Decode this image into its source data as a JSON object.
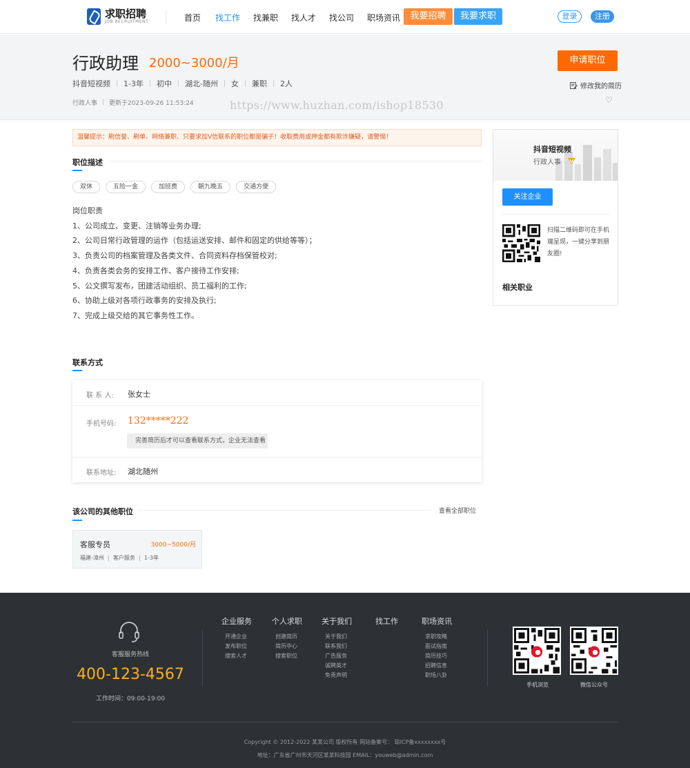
{
  "header": {
    "logo_title": "求职招聘",
    "logo_subtitle": "JOB RECRUITMENT",
    "nav": [
      "首页",
      "找工作",
      "找兼职",
      "找人才",
      "找公司",
      "职场资讯"
    ],
    "active_nav": "找工作",
    "recruit_btn": "我要招聘",
    "seek_btn": "我要求职",
    "login": "登录",
    "register": "注册"
  },
  "job": {
    "title": "行政助理",
    "salary": "2000~3000/月",
    "tags": [
      "抖音短视频",
      "1-3年",
      "初中",
      "湖北-随州",
      "女",
      "兼职",
      "2人"
    ],
    "category": "行政人事",
    "updated": "更新于2023-09-26 11:53:24",
    "apply_btn": "申请职位",
    "edit_resume": "修改我的简历",
    "watermark": "https://www.huzhan.com/ishop18530"
  },
  "warning": "温馨提示：刷信誉、刷单、网络兼职、只要求加V信联系的职位都是骗子！收取费用或押金都有欺诈嫌疑，请警惕！",
  "description": {
    "heading": "职位描述",
    "welfare": [
      "双休",
      "五险一金",
      "加班费",
      "朝九晚五",
      "交通方便"
    ],
    "duties": [
      "岗位职责",
      "1、公司成立、变更、注销等业务办理;",
      "2、公司日常行政管理的运作（包括运送安排、邮件和固定的供给等等）；",
      "3、负责公司的档案管理及各类文件、合同资料存档保管校对;",
      "4、负责各类会务的安排工作、客户接待工作安排;",
      "5、公文撰写发布，团建活动组织、员工福利的工作;",
      "6、协助上级对各项行政事务的安排及执行;",
      "7、完成上级交给的其它事务性工作。"
    ]
  },
  "contact": {
    "heading": "联系方式",
    "person_label": "联 系 人:",
    "person": "张女士",
    "phone_label": "手机号码:",
    "phone": "132*****222",
    "phone_tip": "完善简历后才可以查看联系方式，企业无法查看",
    "address_label": "联系地址:",
    "address": "湖北随州"
  },
  "other_jobs": {
    "heading": "该公司的其他职位",
    "view_all": "查看全部职位",
    "items": [
      {
        "title": "客服专员",
        "salary": "3000~5000/月",
        "tags": [
          "福建-漳州",
          "客户服务",
          "1-3年"
        ]
      }
    ]
  },
  "sidebar": {
    "company_name": "抖音短视频",
    "company_type": "行政人事",
    "follow_btn": "关注企业",
    "qr_text": "扫描二维码即可在手机端呈现，一键分享到朋友圈!",
    "related_title": "相关职业"
  },
  "footer": {
    "hotline_label": "客服服务热线",
    "hotline": "400-123-4567",
    "hours": "工作时间：09:00-19:00",
    "columns": [
      {
        "title": "企业服务",
        "items": [
          "开通企业",
          "发布职位",
          "搜索人才"
        ]
      },
      {
        "title": "个人求职",
        "items": [
          "创建简历",
          "简历中心",
          "搜索职位"
        ]
      },
      {
        "title": "关于我们",
        "items": [
          "关于我们",
          "联系我们",
          "广告服务",
          "诚聘英才",
          "免责声明"
        ]
      },
      {
        "title": "找工作",
        "items": []
      },
      {
        "title": "职场资讯",
        "items": [
          "求职攻略",
          "面试指南",
          "简历技巧",
          "招聘信息",
          "职场八卦"
        ]
      }
    ],
    "qr_mobile": "手机浏览",
    "qr_wechat": "微信公众号",
    "copyright": "Copyright © 2012-2022 某某公司 版权所有 网站备案号： 琼ICP备xxxxxxxx号",
    "address": "地址：广东省广州市天河区某某科技园 EMAIL：youweb@admin.com"
  },
  "colors": {
    "accent_blue": "#1e90ff",
    "accent_orange": "#ff6a00",
    "hotline_yellow": "#f7b11e",
    "footer_bg": "#2d3035"
  }
}
